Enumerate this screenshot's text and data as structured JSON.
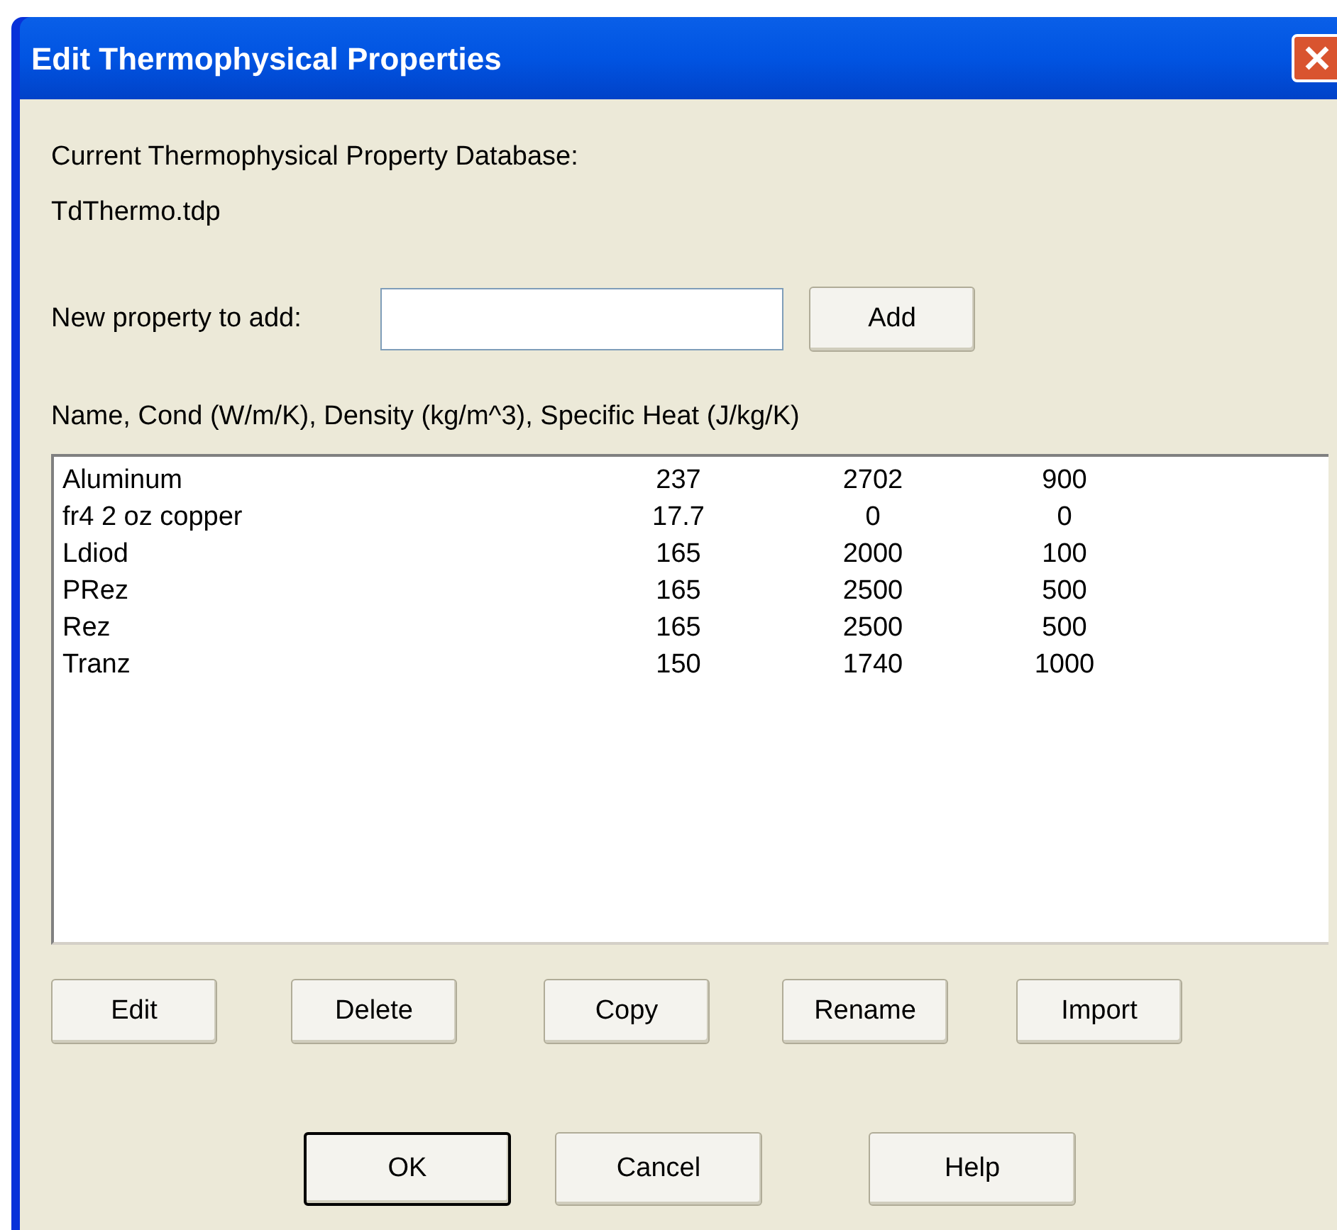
{
  "window": {
    "title": "Edit Thermophysical Properties"
  },
  "database": {
    "label": "Current Thermophysical Property Database:",
    "file": "TdThermo.tdp"
  },
  "new_property": {
    "label": "New property to add:",
    "add_button": "Add"
  },
  "list_header": "Name, Cond (W/m/K), Density (kg/m^3), Specific Heat (J/kg/K)",
  "rows": [
    {
      "name": "Aluminum",
      "cond": "237",
      "density": "2702",
      "specific_heat": "900"
    },
    {
      "name": "fr4 2 oz copper",
      "cond": "17.7",
      "density": "0",
      "specific_heat": "0"
    },
    {
      "name": "Ldiod",
      "cond": "165",
      "density": "2000",
      "specific_heat": "100"
    },
    {
      "name": "PRez",
      "cond": "165",
      "density": "2500",
      "specific_heat": "500"
    },
    {
      "name": "Rez",
      "cond": "165",
      "density": "2500",
      "specific_heat": "500"
    },
    {
      "name": "Tranz",
      "cond": "150",
      "density": "1740",
      "specific_heat": "1000"
    }
  ],
  "list_buttons": [
    "Edit",
    "Delete",
    "Copy",
    "Rename",
    "Import"
  ],
  "dialog_buttons": [
    {
      "label": "OK",
      "default": true
    },
    {
      "label": "Cancel",
      "default": false
    },
    {
      "label": "Help",
      "default": false
    }
  ]
}
